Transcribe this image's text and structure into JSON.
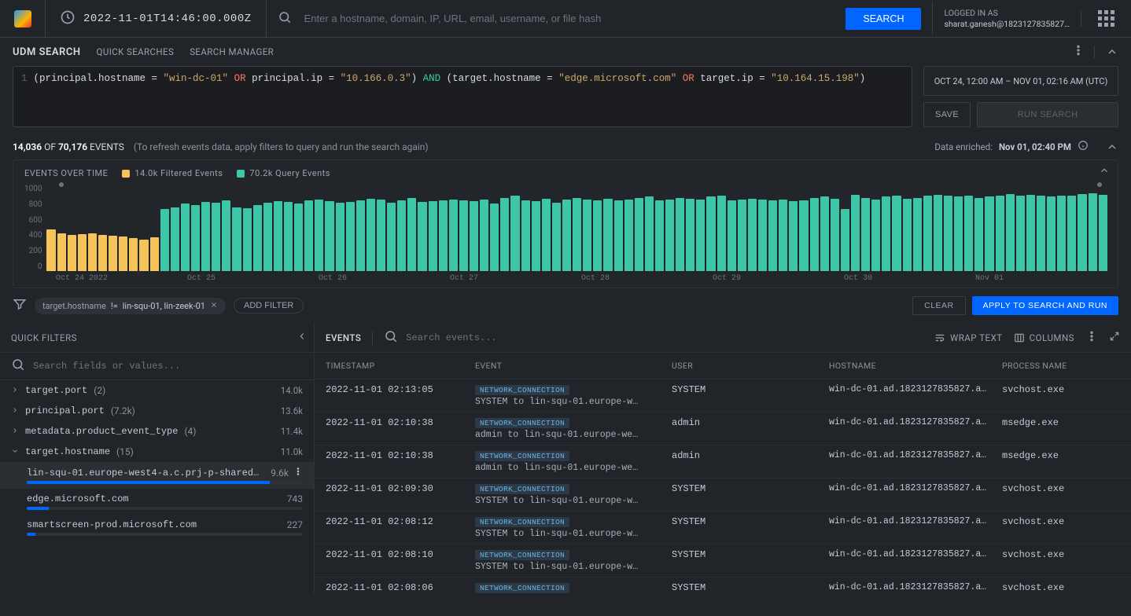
{
  "topbar": {
    "timestamp": "2022-11-01T14:46:00.000Z",
    "search_placeholder": "Enter a hostname, domain, IP, URL, email, username, or file hash",
    "search_button": "SEARCH",
    "login_header": "LOGGED IN AS",
    "login_email": "sharat.ganesh@1823127835827…"
  },
  "udm": {
    "title": "UDM SEARCH",
    "quick_link": "QUICK SEARCHES",
    "manager_link": "SEARCH MANAGER"
  },
  "query": {
    "line_no": "1",
    "text_parts": {
      "p1": "(principal.hostname = ",
      "l1": "\"win-dc-01\"",
      "or1": " OR ",
      "p2": "principal.ip = ",
      "l2": "\"10.166.0.3\"",
      "p3": ") ",
      "and": "AND",
      "p4": " (target.hostname = ",
      "l3": "\"edge.microsoft.com\"",
      "or2": " OR ",
      "p5": "target.ip = ",
      "l4": "\"10.164.15.198\"",
      "p6": ")"
    },
    "range": "OCT 24, 12:00 AM – NOV 01, 02:16 AM (UTC)",
    "save_btn": "SAVE",
    "run_btn": "RUN SEARCH"
  },
  "summary": {
    "counts_html_parts": {
      "a": "14,036",
      "b": "70,176",
      "label": " EVENTS "
    },
    "hint": "(To refresh events data, apply filters to query and run the search again)",
    "enriched_label": "Data enriched: ",
    "enriched_time": "Nov 01, 02:40 PM"
  },
  "chart_data": {
    "type": "bar",
    "title": "EVENTS OVER TIME",
    "legend_filtered": "14.0k Filtered Events",
    "legend_query": "70.2k Query Events",
    "ylabel": "",
    "xlabel": "",
    "ylim": [
      0,
      1000
    ],
    "yticks": [
      "1000",
      "800",
      "600",
      "400",
      "200",
      "0"
    ],
    "xticks": [
      "Oct 24 2022",
      "Oct 25",
      "Oct 26",
      "Oct 27",
      "Oct 28",
      "Oct 29",
      "Oct 30",
      "Nov 01"
    ],
    "series": [
      {
        "name": "Filtered",
        "color": "#f6c458",
        "values": [
          480,
          440,
          420,
          430,
          440,
          420,
          410,
          400,
          380,
          360,
          390
        ]
      },
      {
        "name": "Query",
        "color": "#3ec6a8",
        "values": [
          720,
          740,
          780,
          760,
          800,
          790,
          820,
          740,
          730,
          760,
          790,
          810,
          800,
          780,
          820,
          830,
          810,
          790,
          800,
          820,
          840,
          830,
          790,
          820,
          850,
          800,
          810,
          820,
          830,
          820,
          810,
          830,
          780,
          850,
          870,
          820,
          810,
          840,
          790,
          830,
          850,
          830,
          820,
          840,
          820,
          830,
          850,
          860,
          820,
          830,
          850,
          840,
          830,
          860,
          870,
          820,
          830,
          840,
          830,
          820,
          830,
          810,
          820,
          850,
          860,
          840,
          720,
          880,
          850,
          830,
          860,
          870,
          840,
          850,
          870,
          880,
          870,
          860,
          870,
          850,
          860,
          870,
          890,
          870,
          880,
          870,
          860,
          870,
          870,
          890,
          900,
          880
        ]
      }
    ]
  },
  "filterbar": {
    "chip_field": "target.hostname",
    "chip_op": "!=",
    "chip_vals": "lin-squ-01, lin-zeek-01",
    "add": "ADD FILTER",
    "clear": "CLEAR",
    "apply": "APPLY TO SEARCH AND RUN"
  },
  "quick_filters": {
    "title": "QUICK FILTERS",
    "search_placeholder": "Search fields or values...",
    "rows": [
      {
        "kind": "grp",
        "name": "target.port",
        "count": "(2)",
        "val": "14.0k"
      },
      {
        "kind": "grp",
        "name": "principal.port",
        "count": "(7.2k)",
        "val": "13.6k"
      },
      {
        "kind": "grp",
        "name": "metadata.product_event_type",
        "count": "(4)",
        "val": "11.4k"
      },
      {
        "kind": "grp-open",
        "name": "target.hostname",
        "count": "(15)",
        "val": "11.0k"
      },
      {
        "kind": "leaf",
        "name": "lin-squ-01.europe-west4-a.c.prj-p-shared-b…",
        "val": "9.6k",
        "pct": 88,
        "hover": true
      },
      {
        "kind": "leaf",
        "name": "edge.microsoft.com",
        "val": "743",
        "pct": 8
      },
      {
        "kind": "leaf",
        "name": "smartscreen-prod.microsoft.com",
        "val": "227",
        "pct": 3
      }
    ]
  },
  "events": {
    "title": "EVENTS",
    "search_placeholder": "Search events...",
    "wrap": "WRAP TEXT",
    "columns_btn": "COLUMNS",
    "cols": {
      "ts": "TIMESTAMP",
      "ev": "EVENT",
      "usr": "USER",
      "host": "HOSTNAME",
      "proc": "PROCESS NAME"
    },
    "rows": [
      {
        "ts": "2022-11-01 02:13:05",
        "kind": "NETWORK_CONNECTION",
        "desc": "SYSTEM to lin-squ-01.europe-w…",
        "user": "SYSTEM",
        "host": "win-dc-01.ad.1823127835827.a…",
        "proc": "svchost.exe"
      },
      {
        "ts": "2022-11-01 02:10:38",
        "kind": "NETWORK_CONNECTION",
        "desc": "admin to lin-squ-01.europe-we…",
        "user": "admin",
        "host": "win-dc-01.ad.1823127835827.a…",
        "proc": "msedge.exe"
      },
      {
        "ts": "2022-11-01 02:10:38",
        "kind": "NETWORK_CONNECTION",
        "desc": "admin to lin-squ-01.europe-we…",
        "user": "admin",
        "host": "win-dc-01.ad.1823127835827.a…",
        "proc": "msedge.exe"
      },
      {
        "ts": "2022-11-01 02:09:30",
        "kind": "NETWORK_CONNECTION",
        "desc": "SYSTEM to lin-squ-01.europe-w…",
        "user": "SYSTEM",
        "host": "win-dc-01.ad.1823127835827.a…",
        "proc": "svchost.exe"
      },
      {
        "ts": "2022-11-01 02:08:12",
        "kind": "NETWORK_CONNECTION",
        "desc": "SYSTEM to lin-squ-01.europe-w…",
        "user": "SYSTEM",
        "host": "win-dc-01.ad.1823127835827.a…",
        "proc": "svchost.exe"
      },
      {
        "ts": "2022-11-01 02:08:10",
        "kind": "NETWORK_CONNECTION",
        "desc": "SYSTEM to lin-squ-01.europe-w…",
        "user": "SYSTEM",
        "host": "win-dc-01.ad.1823127835827.a…",
        "proc": "svchost.exe"
      },
      {
        "ts": "2022-11-01 02:08:06",
        "kind": "NETWORK_CONNECTION",
        "desc": "",
        "user": "SYSTEM",
        "host": "win-dc-01.ad.1823127835827.a…",
        "proc": "svchost.exe"
      }
    ]
  }
}
